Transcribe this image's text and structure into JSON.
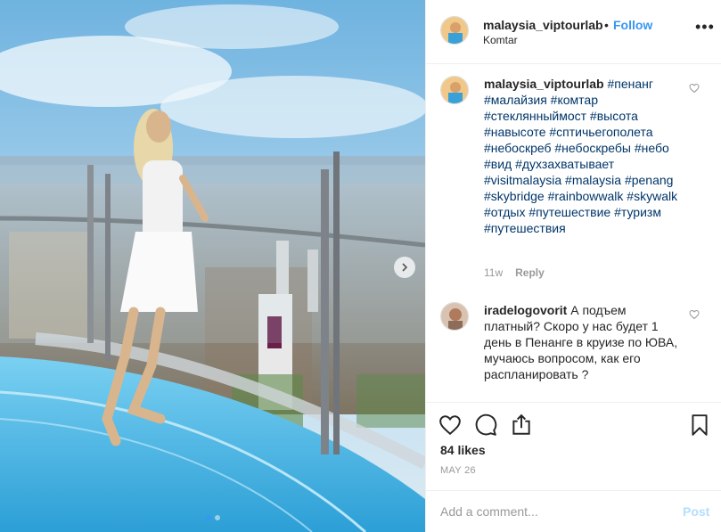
{
  "post": {
    "photo": {
      "carousel_dots": 2,
      "active_dot": 1
    },
    "header": {
      "username": "malaysia_viptourlab",
      "separator": "•",
      "follow_label": "Follow",
      "location": "Komtar"
    },
    "caption": {
      "username": "malaysia_viptourlab",
      "text": "#пенанг #малайзия #комтар #стеклянныймост #высота #навысоте #сптичьегополета #небоскреб #небоскребы #небо #вид #духзахватывает #visitmalaysia #malaysia #penang #skybridge #rainbowwalk #skywalk #отдых #путешествие #туризм #путешествия",
      "time": "11w",
      "reply_label": "Reply"
    },
    "comment": {
      "username": "iradelogovorit",
      "text": "А подъем платный? Скоро у нас будет 1 день в Пенанге в круизе по ЮВА, мучаюсь вопросом, как его распланировать ?"
    },
    "likes": "84 likes",
    "date": "MAY 26",
    "add_comment": {
      "placeholder": "Add a comment...",
      "post_label": "Post"
    }
  },
  "colors": {
    "link": "#3897f0",
    "hashtag": "#003569",
    "muted": "#999999",
    "post_disabled": "#b2dffc"
  },
  "icons": [
    "chevron-right-icon",
    "more-options-icon",
    "heart-icon",
    "comment-icon",
    "share-icon",
    "bookmark-icon"
  ]
}
